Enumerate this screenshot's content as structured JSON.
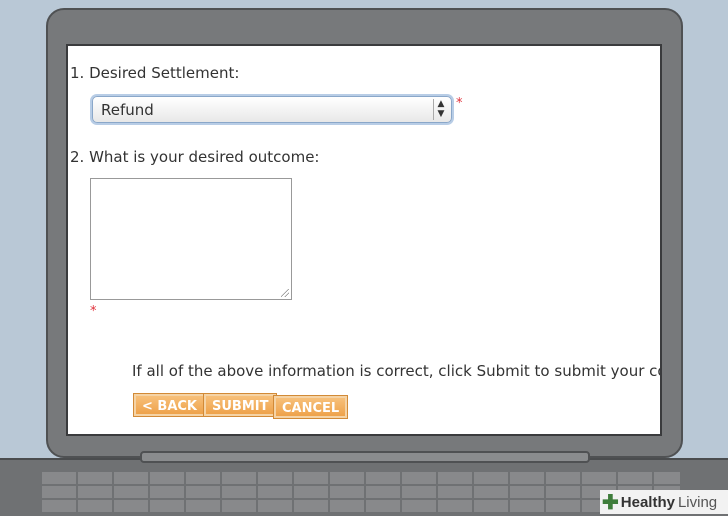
{
  "form": {
    "q1_label": "1. Desired Settlement:",
    "settlement_value": "Refund",
    "required_mark": "*",
    "q2_label": "2. What is your desired outcome:",
    "outcome_value": "",
    "info_text": "If all of the above information is correct, click Submit to submit your complaint"
  },
  "buttons": {
    "back": "< BACK",
    "submit": "SUBMIT",
    "cancel": "CANCEL"
  },
  "brand": {
    "name_bold": "Healthy",
    "name_light": "Living",
    "icon": "plus-icon"
  }
}
